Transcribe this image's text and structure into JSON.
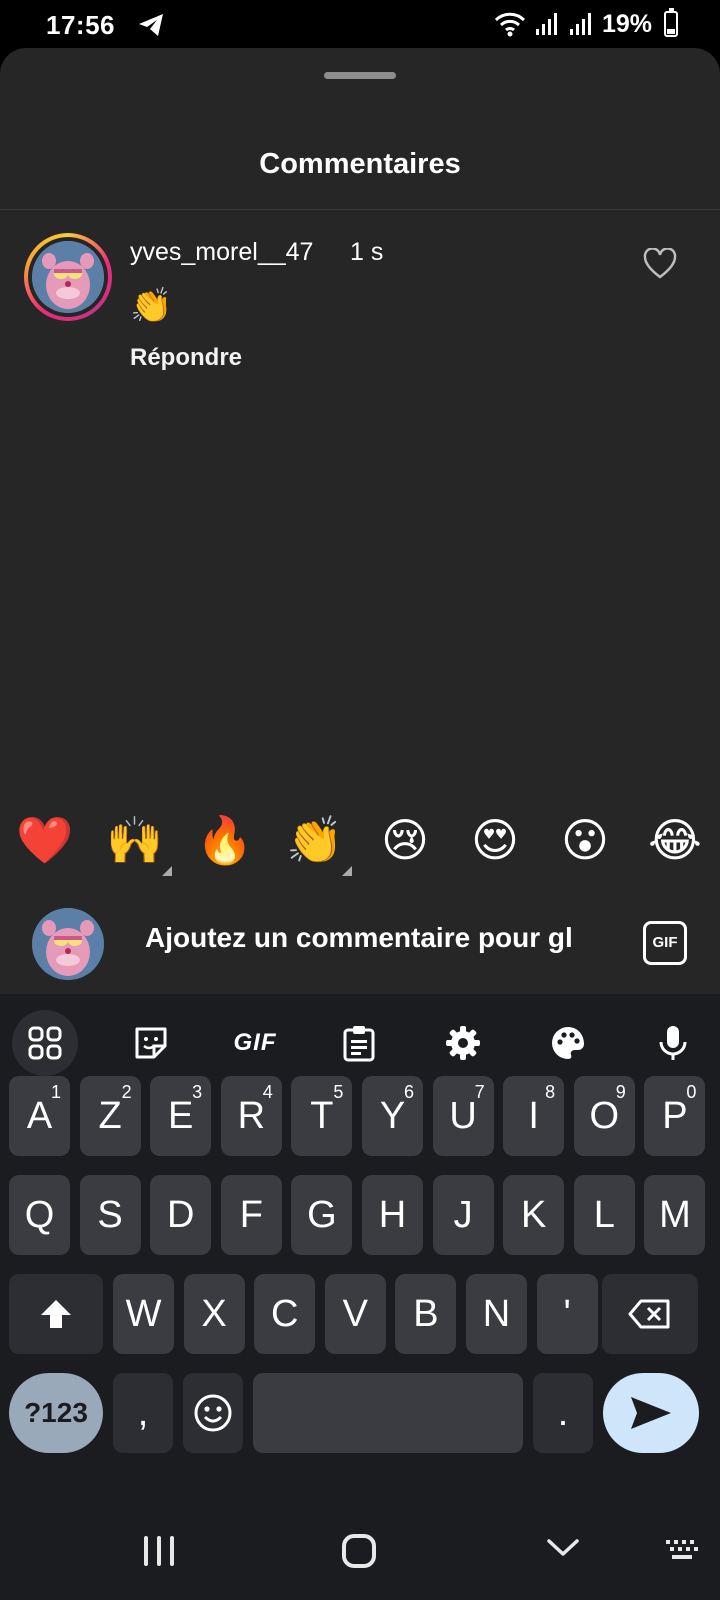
{
  "status_bar": {
    "time": "17:56",
    "battery": "19%"
  },
  "sheet": {
    "title": "Commentaires"
  },
  "comment": {
    "username": "yves_morel__47",
    "time": "1 s",
    "text": "👏",
    "reply_label": "Répondre"
  },
  "emoji_bar": [
    "❤️",
    "🙌",
    "🔥",
    "👏",
    "😢",
    "😍",
    "😮",
    "😂"
  ],
  "input": {
    "placeholder": "Ajoutez un commentaire pour gl",
    "gif_label": "GIF"
  },
  "keyboard": {
    "toolbar_gif": "GIF",
    "row1": [
      {
        "k": "A",
        "h": "1"
      },
      {
        "k": "Z",
        "h": "2"
      },
      {
        "k": "E",
        "h": "3"
      },
      {
        "k": "R",
        "h": "4"
      },
      {
        "k": "T",
        "h": "5"
      },
      {
        "k": "Y",
        "h": "6"
      },
      {
        "k": "U",
        "h": "7"
      },
      {
        "k": "I",
        "h": "8"
      },
      {
        "k": "O",
        "h": "9"
      },
      {
        "k": "P",
        "h": "0"
      }
    ],
    "row2": [
      "Q",
      "S",
      "D",
      "F",
      "G",
      "H",
      "J",
      "K",
      "L",
      "M"
    ],
    "row3": [
      "W",
      "X",
      "C",
      "V",
      "B",
      "N",
      "'"
    ],
    "mode_key": "?123",
    "comma": ",",
    "period": "."
  },
  "colors": {
    "sheet_bg": "#262626",
    "keyboard_bg": "#1b1c1f",
    "key_bg": "#3a3c41",
    "send_bg": "#cfe6fa"
  }
}
